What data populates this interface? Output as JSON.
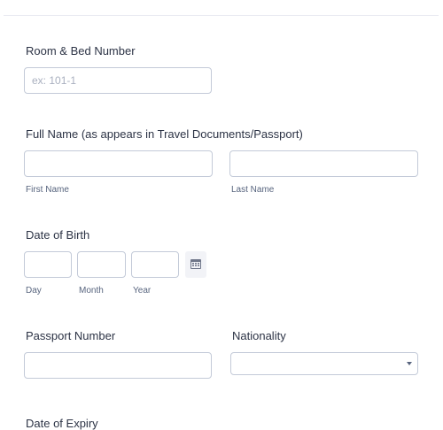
{
  "room": {
    "label": "Room & Bed Number",
    "placeholder": "ex: 101-1"
  },
  "full_name": {
    "label": "Full Name (as appears in Travel Documents/Passport)",
    "first_sublabel": "First Name",
    "last_sublabel": "Last Name"
  },
  "dob": {
    "label": "Date of Birth",
    "day_sublabel": "Day",
    "month_sublabel": "Month",
    "year_sublabel": "Year",
    "calendar_icon": "calendar-icon"
  },
  "passport": {
    "label": "Passport Number"
  },
  "nationality": {
    "label": "Nationality",
    "selected": ""
  },
  "expiry": {
    "label": "Date of Expiry"
  }
}
